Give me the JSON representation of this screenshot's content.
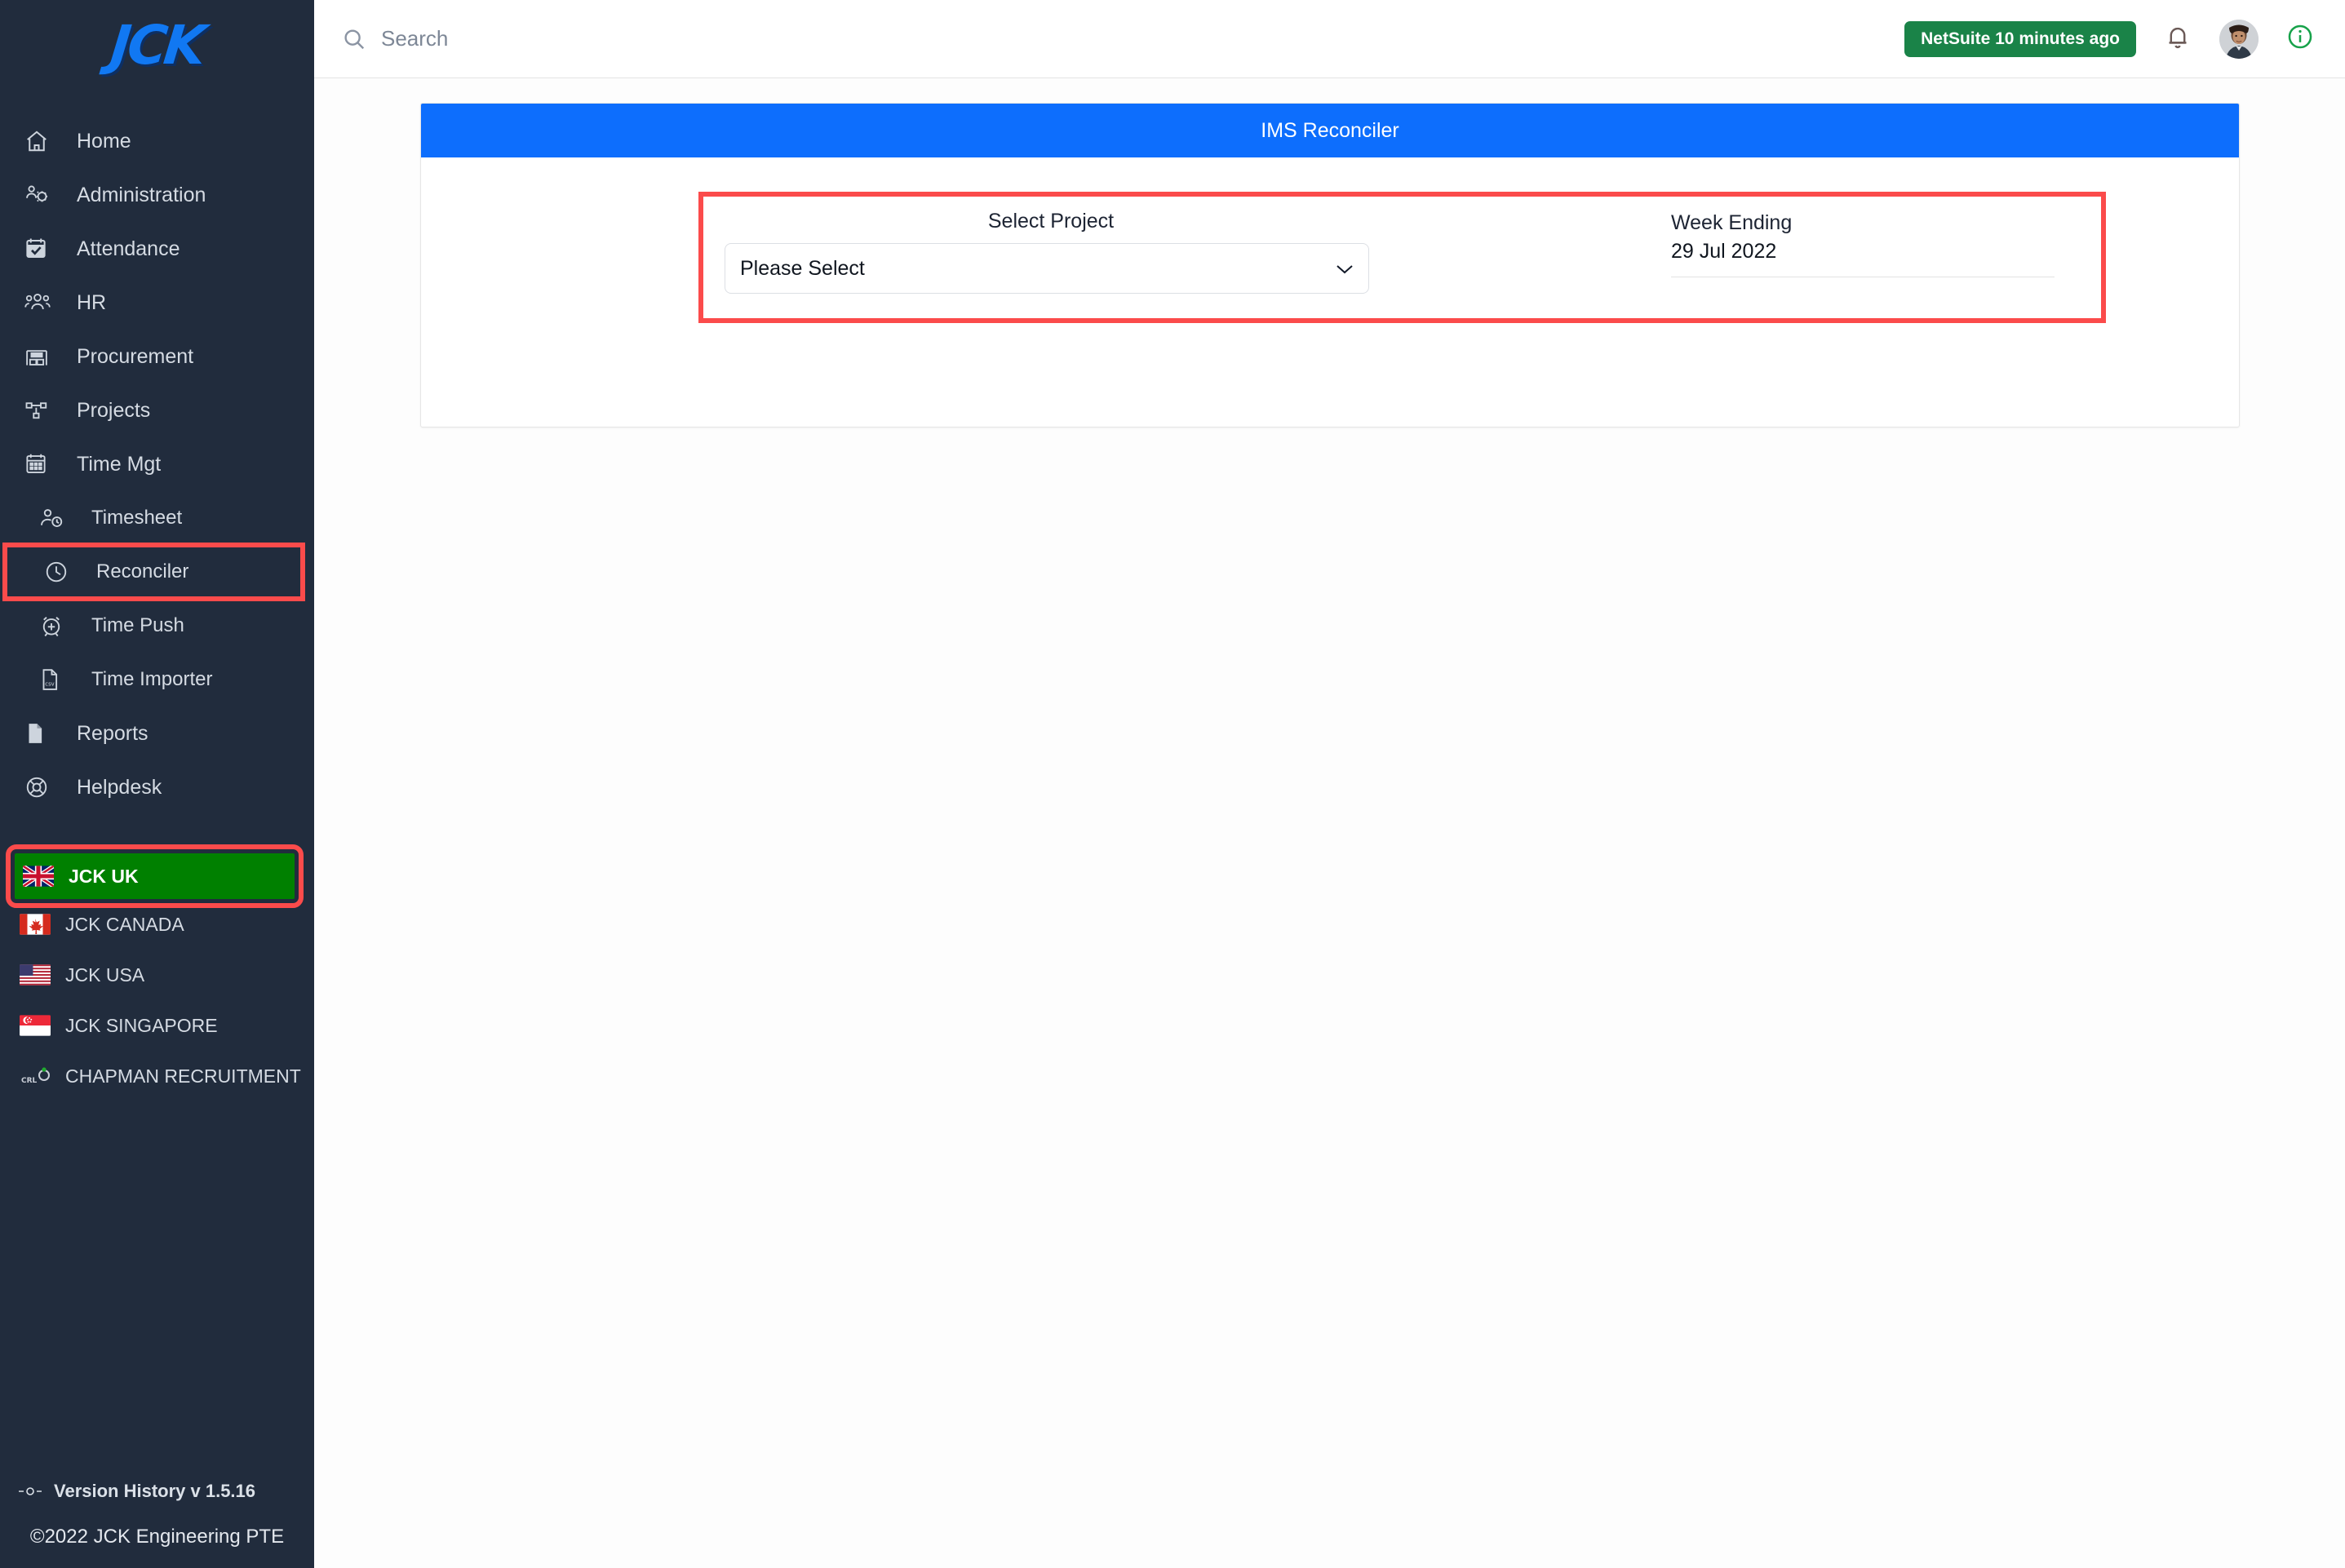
{
  "brand": {
    "logo_text": "JCK"
  },
  "sidebar": {
    "nav": [
      {
        "label": "Home",
        "icon": "home-icon"
      },
      {
        "label": "Administration",
        "icon": "admin-users-gear-icon"
      },
      {
        "label": "Attendance",
        "icon": "calendar-check-icon"
      },
      {
        "label": "HR",
        "icon": "people-group-icon"
      },
      {
        "label": "Procurement",
        "icon": "warehouse-icon"
      },
      {
        "label": "Projects",
        "icon": "sitemap-icon"
      },
      {
        "label": "Time Mgt",
        "icon": "calendar-grid-icon"
      },
      {
        "label": "Timesheet",
        "icon": "user-clock-icon"
      },
      {
        "label": "Reconciler",
        "icon": "clock-icon"
      },
      {
        "label": "Time Push",
        "icon": "alarm-plus-icon"
      },
      {
        "label": "Time Importer",
        "icon": "csv-file-icon"
      },
      {
        "label": "Reports",
        "icon": "document-icon"
      },
      {
        "label": "Helpdesk",
        "icon": "lifebuoy-icon"
      }
    ],
    "countries": [
      {
        "label": "JCK UK",
        "flag": "uk-flag"
      },
      {
        "label": "JCK CANADA",
        "flag": "canada-flag"
      },
      {
        "label": "JCK USA",
        "flag": "usa-flag"
      },
      {
        "label": "JCK SINGAPORE",
        "flag": "singapore-flag"
      },
      {
        "label": "CHAPMAN RECRUITMENT",
        "flag": "crl-logo"
      }
    ],
    "version_label": "Version History v 1.5.16",
    "copyright": "©2022 JCK Engineering PTE"
  },
  "topbar": {
    "search_placeholder": "Search",
    "search_value": "",
    "netsuite_badge": "NetSuite 10 minutes ago"
  },
  "card": {
    "title": "IMS Reconciler",
    "project_label": "Select Project",
    "project_selected": "Please Select",
    "week_label": "Week Ending",
    "week_value": "29 Jul 2022"
  },
  "colors": {
    "sidebar_bg": "#212c3d",
    "accent_blue": "#0d6efd",
    "logo_blue": "#1178f2",
    "annotation_red": "#fb4b4b",
    "selected_green": "#008000",
    "netsuite_green": "#1a8348"
  }
}
